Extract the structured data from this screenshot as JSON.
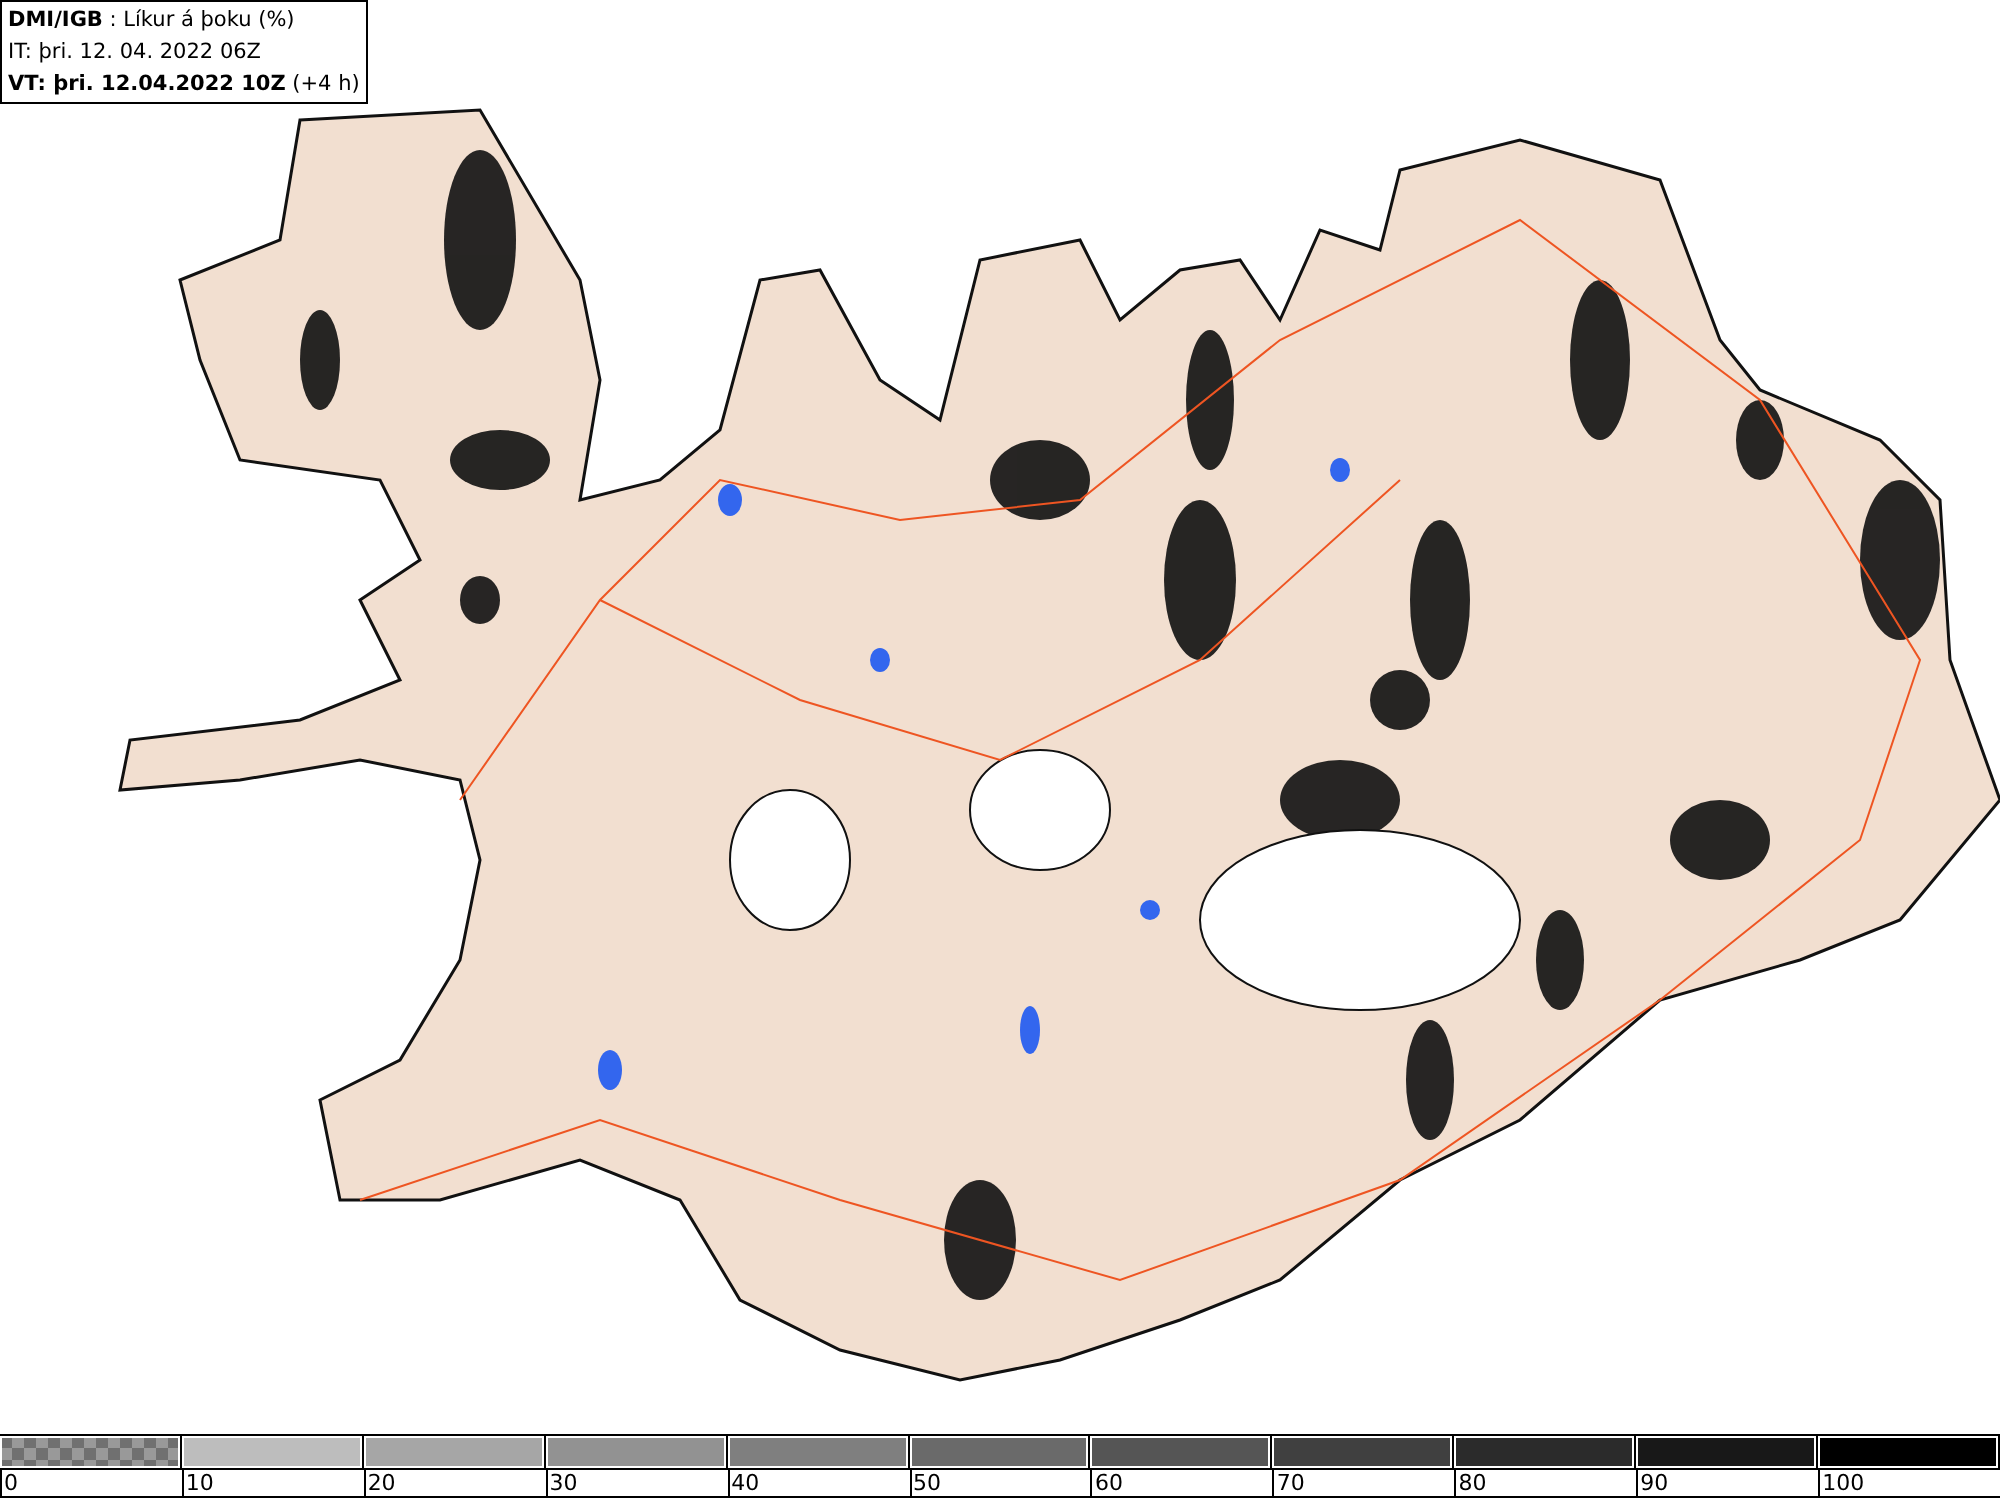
{
  "header": {
    "lines": [
      "**DMI/IGB** : Líkur á þoku (%)",
      "IT: þri. 12. 04. 2022 06Z",
      "**VT: þri. 12.04.2022 10Z** (+4 h)"
    ]
  },
  "legend": {
    "bins": [
      {
        "kind": "checker",
        "color": "#707070"
      },
      {
        "kind": "solid",
        "color": "#bdbdbd"
      },
      {
        "kind": "solid",
        "color": "#a6a6a6"
      },
      {
        "kind": "solid",
        "color": "#929292"
      },
      {
        "kind": "solid",
        "color": "#7f7f7f"
      },
      {
        "kind": "solid",
        "color": "#6a6a6a"
      },
      {
        "kind": "solid",
        "color": "#555555"
      },
      {
        "kind": "solid",
        "color": "#404040"
      },
      {
        "kind": "solid",
        "color": "#2b2b2b"
      },
      {
        "kind": "solid",
        "color": "#181818"
      },
      {
        "kind": "solid",
        "color": "#000000"
      }
    ],
    "labels": [
      "0",
      "10",
      "20",
      "30",
      "40",
      "50",
      "60",
      "70",
      "80",
      "90",
      "100"
    ]
  }
}
